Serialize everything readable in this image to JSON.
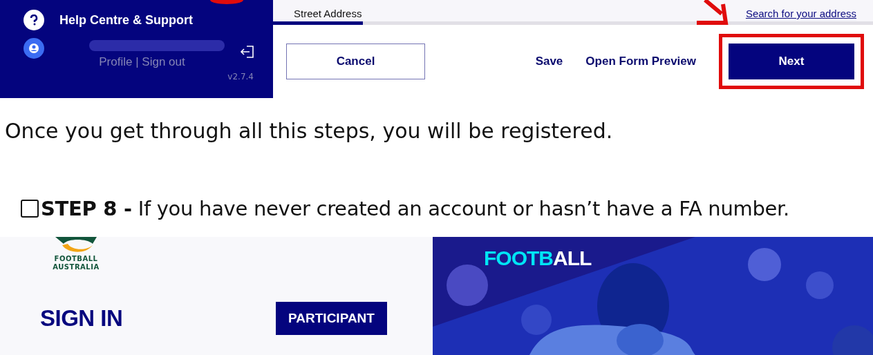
{
  "top_screenshot": {
    "sidebar": {
      "help_label": "Help Centre & Support",
      "profile_links": "Profile | Sign out",
      "version": "v2.7.4"
    },
    "form": {
      "field_label": "Street Address",
      "search_link": "Search for your address",
      "progress": {
        "level": 0.15
      },
      "buttons": [
        {
          "label": "Cancel",
          "kind": "outline"
        },
        {
          "label": "Save",
          "kind": "text"
        },
        {
          "label": "Open Form Preview",
          "kind": "text"
        },
        {
          "label": "Next",
          "kind": "primary",
          "highlighted": true
        }
      ]
    }
  },
  "instruction": "Once you get through all this steps, you will be registered.",
  "step": {
    "checked": false,
    "text": "**STEP 8 -** If you have never created an account or hasn’t have a FA number."
  },
  "bottom_screenshot": {
    "logo_text": "FOOTBALL AUSTRALIA",
    "heading": "SIGN IN",
    "role_button": "PARTICIPANT",
    "hero_logo": [
      {
        "text": "FOOTB",
        "color": "#00e5f5"
      },
      {
        "text": "ALL",
        "color": "#ffffff"
      }
    ]
  }
}
